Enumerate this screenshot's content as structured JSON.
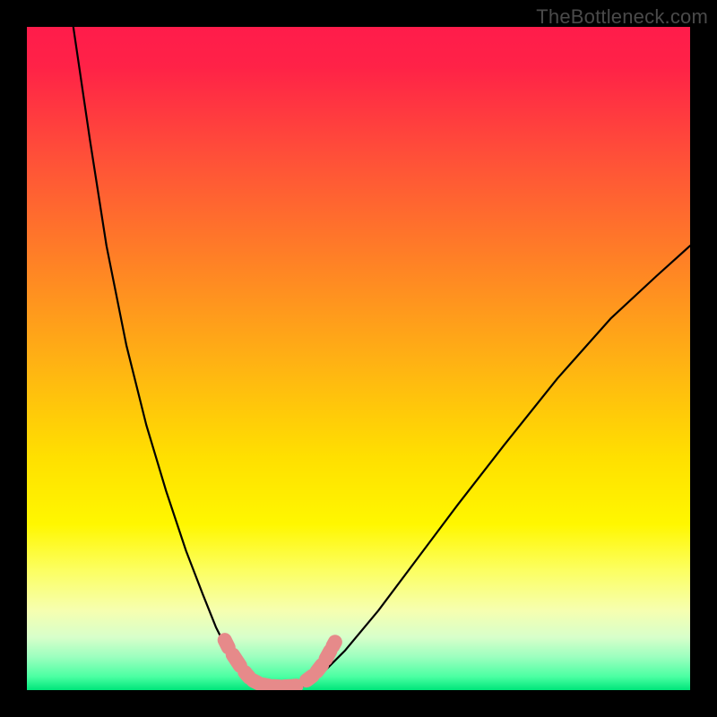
{
  "watermark": {
    "text": "TheBottleneck.com"
  },
  "chart_data": {
    "type": "line",
    "title": "",
    "xlabel": "",
    "ylabel": "",
    "xlim": [
      0,
      100
    ],
    "ylim": [
      0,
      100
    ],
    "grid": false,
    "legend": false,
    "annotations": [],
    "gradient_stops": [
      {
        "pos": 0.0,
        "color": "#ff1c4b"
      },
      {
        "pos": 0.2,
        "color": "#ff5138"
      },
      {
        "pos": 0.5,
        "color": "#ffb014"
      },
      {
        "pos": 0.75,
        "color": "#fff700"
      },
      {
        "pos": 0.95,
        "color": "#9cffbf"
      },
      {
        "pos": 1.0,
        "color": "#00e57a"
      }
    ],
    "series": [
      {
        "name": "left-branch",
        "type": "line",
        "x": [
          7.0,
          9.5,
          12.0,
          15.0,
          18.0,
          21.0,
          24.0,
          26.5,
          28.5,
          30.5,
          32.0,
          33.5,
          34.5
        ],
        "y": [
          100.0,
          83.0,
          67.0,
          52.0,
          40.0,
          30.0,
          21.0,
          14.5,
          9.5,
          5.5,
          3.0,
          1.3,
          0.5
        ]
      },
      {
        "name": "valley-floor",
        "type": "line",
        "x": [
          34.5,
          36.0,
          38.0,
          40.0,
          41.5
        ],
        "y": [
          0.5,
          0.3,
          0.2,
          0.3,
          0.5
        ]
      },
      {
        "name": "right-branch",
        "type": "line",
        "x": [
          41.5,
          44.0,
          48.0,
          53.0,
          59.0,
          65.0,
          72.0,
          80.0,
          88.0,
          95.0,
          100.0
        ],
        "y": [
          0.5,
          2.0,
          6.0,
          12.0,
          20.0,
          28.0,
          37.0,
          47.0,
          56.0,
          62.5,
          67.0
        ]
      },
      {
        "name": "left-marker-strip",
        "type": "scatter",
        "marker": "pink-capsule",
        "color": "#e68a8a",
        "x": [
          29.6,
          30.6,
          32.6,
          33.8,
          35.2,
          36.8,
          38.4,
          40.0
        ],
        "y": [
          8.0,
          6.0,
          3.0,
          1.6,
          0.9,
          0.6,
          0.5,
          0.6
        ]
      },
      {
        "name": "right-marker-strip",
        "type": "scatter",
        "marker": "pink-capsule",
        "color": "#e68a8a",
        "x": [
          41.8,
          43.4,
          44.8,
          46.0
        ],
        "y": [
          1.2,
          2.4,
          4.2,
          6.4
        ]
      }
    ]
  }
}
